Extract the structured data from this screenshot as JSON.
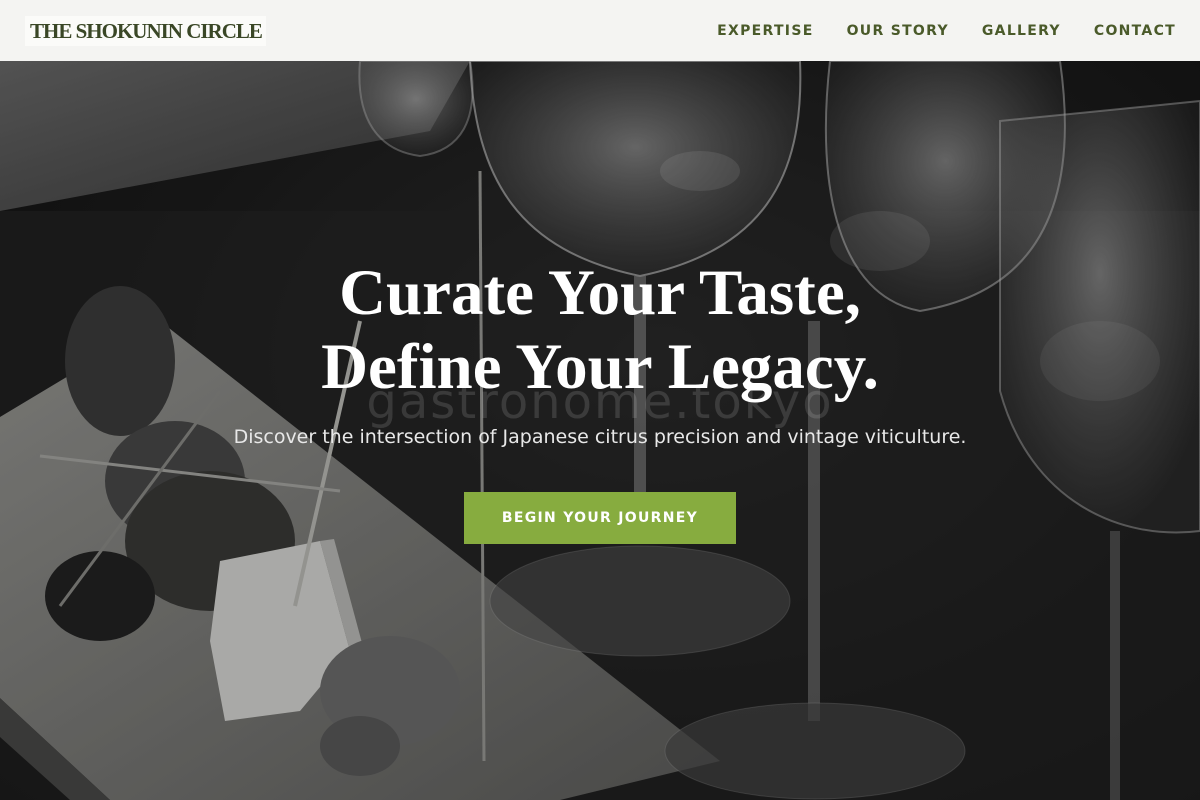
{
  "brand": {
    "name": "THE SHOKUNIN CIRCLE"
  },
  "nav": {
    "items": [
      {
        "label": "EXPERTISE"
      },
      {
        "label": "OUR STORY"
      },
      {
        "label": "GALLERY"
      },
      {
        "label": "CONTACT"
      }
    ]
  },
  "hero": {
    "headline_line1": "Curate Your Taste,",
    "headline_line2": "Define Your Legacy.",
    "watermark": "gastronome.tokyo",
    "subheadline": "Discover the intersection of Japanese citrus precision and vintage viticulture.",
    "cta_label": "BEGIN YOUR JOURNEY"
  },
  "colors": {
    "header_bg": "#f4f4f2",
    "brand_text": "#3a4726",
    "nav_text": "#4a5a2a",
    "cta_bg": "#87ac3f",
    "hero_text": "#ffffff"
  }
}
